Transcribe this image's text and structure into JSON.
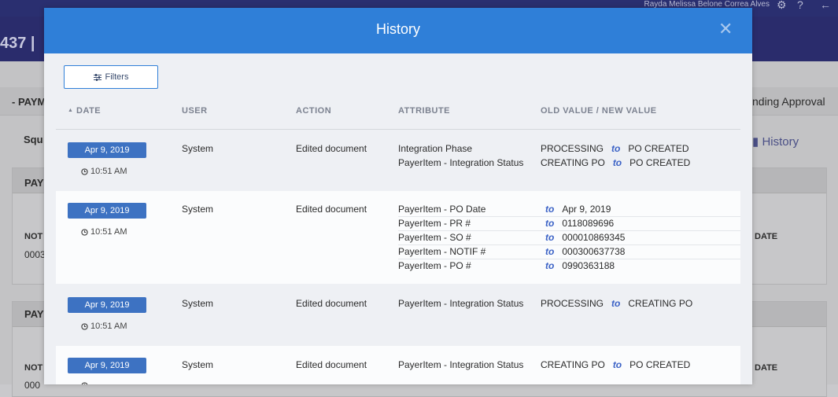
{
  "app": {
    "user_name": "Rayda Melissa Belone Correa Alves",
    "title_fragment": "437 |",
    "section_fragment": "- PAYM",
    "status_fragment": "nding Approval",
    "label_squ": "Squ",
    "history_link": "History",
    "panel1_head": "PAY",
    "panel1_not": "NOT",
    "panel1_val": "0003",
    "panel1_date": "DATE",
    "panel2_head": "PAY",
    "panel2_not": "NOT",
    "panel2_val": "000",
    "panel2_date": "DATE",
    "icons": [
      "gear-icon",
      "help-icon",
      "back-arrow-icon"
    ]
  },
  "modal": {
    "title": "History",
    "filters_label": "Filters",
    "columns": {
      "date": "DATE",
      "user": "USER",
      "action": "ACTION",
      "attribute": "ATTRIBUTE",
      "values": "OLD VALUE / NEW VALUE"
    },
    "to_word": "to",
    "rows": [
      {
        "date": "Apr 9, 2019",
        "time": "10:51 AM",
        "user": "System",
        "action": "Edited document",
        "changes": [
          {
            "attribute": "Integration Phase",
            "old": "PROCESSING",
            "new": "PO CREATED"
          },
          {
            "attribute": "PayerItem - Integration Status",
            "old": "CREATING PO",
            "new": "PO CREATED"
          }
        ]
      },
      {
        "date": "Apr 9, 2019",
        "time": "10:51 AM",
        "user": "System",
        "action": "Edited document",
        "changes": [
          {
            "attribute": "PayerItem - PO Date",
            "old": "",
            "new": "Apr 9, 2019"
          },
          {
            "attribute": "PayerItem - PR #",
            "old": "",
            "new": "0118089696"
          },
          {
            "attribute": "PayerItem - SO #",
            "old": "",
            "new": "000010869345"
          },
          {
            "attribute": "PayerItem - NOTIF #",
            "old": "",
            "new": "000300637738"
          },
          {
            "attribute": "PayerItem - PO #",
            "old": "",
            "new": "0990363188"
          }
        ]
      },
      {
        "date": "Apr 9, 2019",
        "time": "10:51 AM",
        "user": "System",
        "action": "Edited document",
        "changes": [
          {
            "attribute": "PayerItem - Integration Status",
            "old": "PROCESSING",
            "new": "CREATING PO"
          }
        ]
      },
      {
        "date": "Apr 9, 2019",
        "time": "",
        "user": "System",
        "action": "Edited document",
        "changes": [
          {
            "attribute": "PayerItem - Integration Status",
            "old": "CREATING PO",
            "new": "PO CREATED"
          }
        ]
      }
    ]
  }
}
